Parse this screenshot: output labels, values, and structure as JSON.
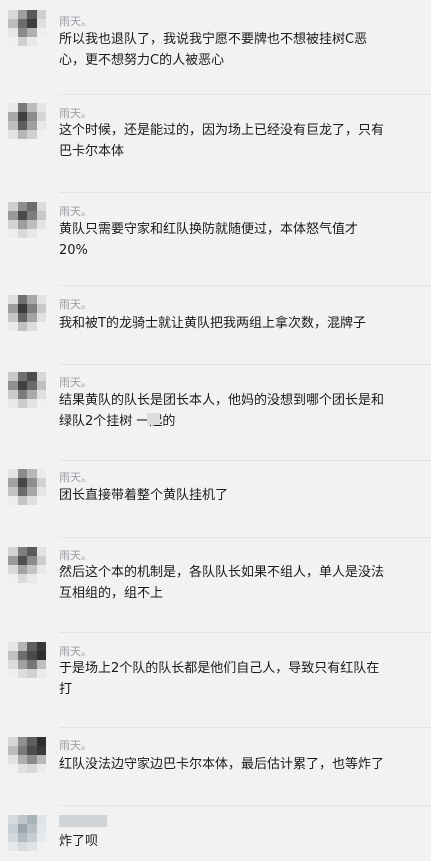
{
  "messages": [
    {
      "name": "雨天。",
      "text": "所以我也退队了，我说我宁愿不要牌也不想被挂树C恶\n心，更不想努力C的人被恶心"
    },
    {
      "name": "雨天。",
      "text": "这个时候，还是能过的，因为场上已经没有巨龙了，只有\n巴卡尔本体"
    },
    {
      "name": "雨天。",
      "text": "黄队只需要守家和红队换防就随便过，本体怒气值才\n20%"
    },
    {
      "name": "雨天。",
      "text": "我和被T的龙骑士就让黄队把我两组上拿次数，混牌子"
    },
    {
      "name": "雨天。",
      "text": "结果黄队的队长是团长本人，他妈的没想到哪个团长是和\n绿队2个挂树    一起的"
    },
    {
      "name": "雨天。",
      "text": "团长直接带着整个黄队挂机了"
    },
    {
      "name": "雨天。",
      "text": "然后这个本的机制是，各队队长如果不组人，单人是没法\n互相组的，组不上"
    },
    {
      "name": "雨天。",
      "text": "于是场上2个队的队长都是他们自己人，导致只有红队在\n打"
    },
    {
      "name": "雨天。",
      "text": "红队没法边守家边巴卡尔本体，最后估计累了，也等炸了"
    },
    {
      "name": "",
      "text": "炸了呗"
    }
  ]
}
